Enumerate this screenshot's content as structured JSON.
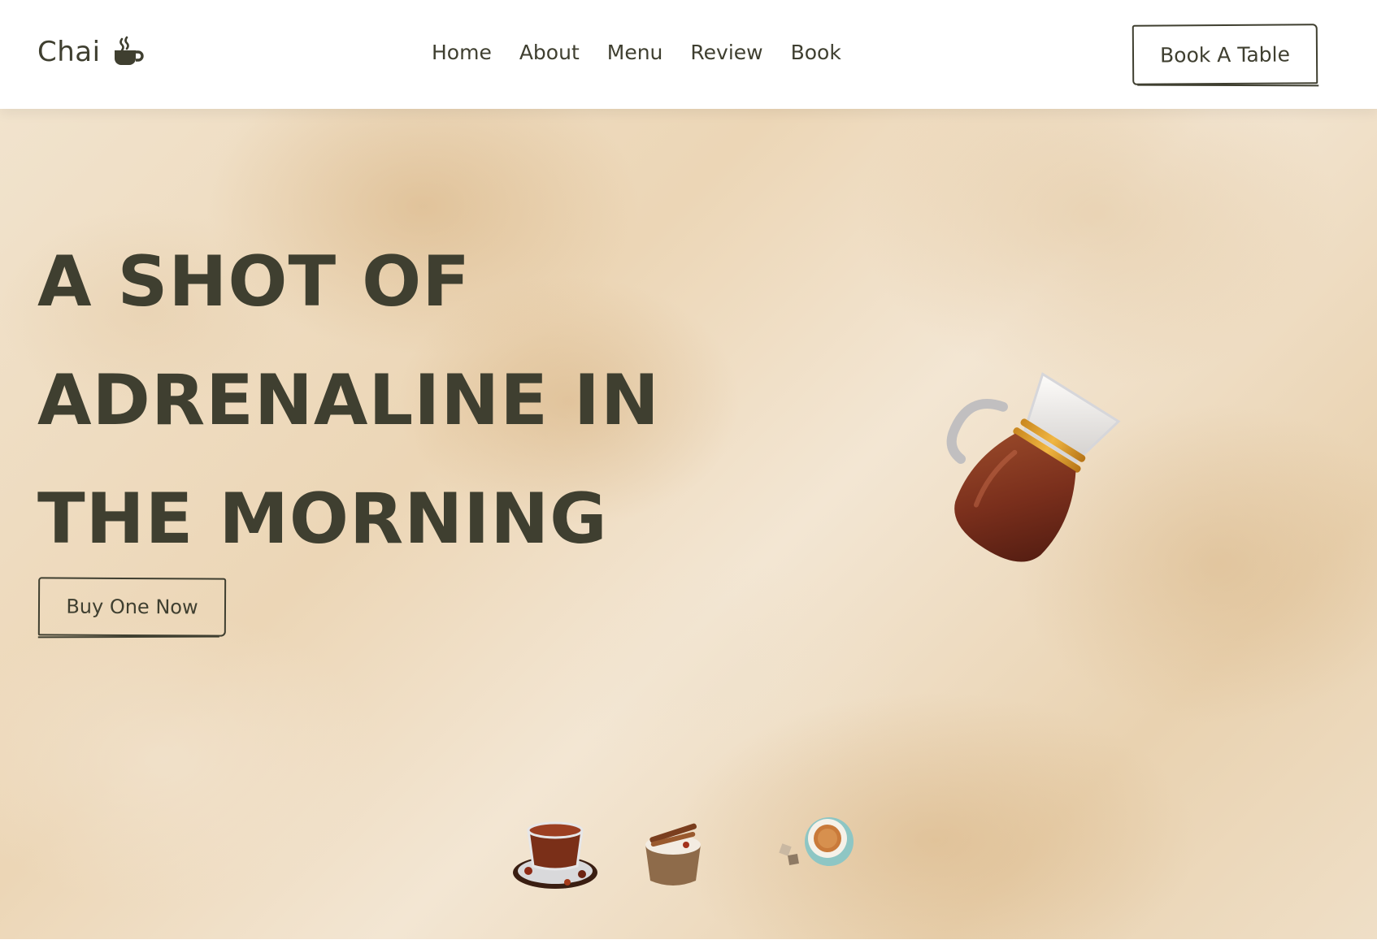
{
  "brand": {
    "name": "Chai",
    "icon": "coffee-cup-icon"
  },
  "nav": {
    "items": [
      {
        "label": "Home"
      },
      {
        "label": "About"
      },
      {
        "label": "Menu"
      },
      {
        "label": "Review"
      },
      {
        "label": "Book"
      }
    ]
  },
  "header": {
    "cta_label": "Book A Table"
  },
  "hero": {
    "headline_lines": [
      "A SHOT OF",
      "ADRENALINE IN",
      "THE MORNING"
    ],
    "cta_label": "Buy One Now",
    "main_image": "tea-kettle-image",
    "thumbnails": [
      {
        "name": "glass-tea-cup-thumbnail"
      },
      {
        "name": "masala-chai-cup-thumbnail"
      },
      {
        "name": "tea-cup-saucer-thumbnail"
      }
    ]
  },
  "colors": {
    "text": "#3f3f30",
    "background_tint": "#ecd6b6",
    "header_bg": "#ffffff"
  }
}
